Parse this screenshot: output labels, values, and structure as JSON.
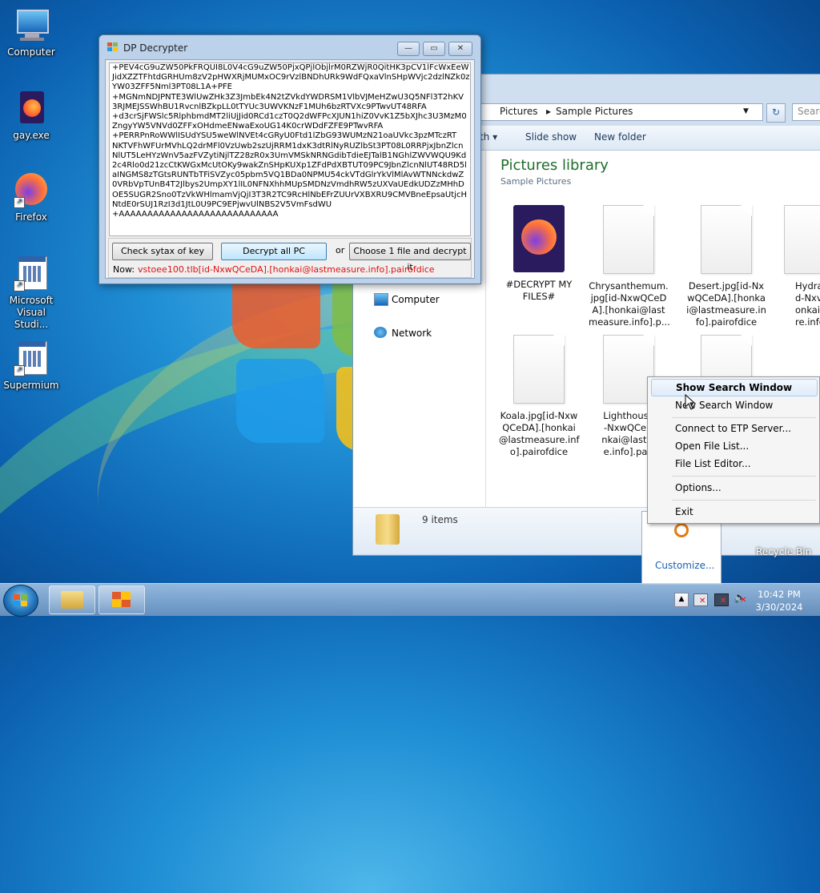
{
  "desktop": {
    "icons": [
      {
        "label": "Computer"
      },
      {
        "label": "gay.exe"
      },
      {
        "label": "Firefox"
      },
      {
        "label_line1": "Microsoft",
        "label_line2": "Visual Studi..."
      },
      {
        "label": "Supermium"
      }
    ],
    "recycle_label": "Recycle Bin"
  },
  "decrypter": {
    "title": "DP Decrypter",
    "key_lines": [
      "+PEV4cG9uZW50PkFRQUI8L0V4cG9uZW50PjxQPjlObjlrM0RZWjR0QitHK3pCV1lFcWxEeW",
      "JidXZZTFhtdGRHUm8zV2pHWXRjMUMxOC9rVzlBNDhURk9WdFQxaVlnSHpWVjc2dzlNZk0z",
      "YW03ZFF5Nml3PT08L1A+PFE",
      "+MGNmNDJPNTE3WlUwZHk3Z3JmbEk4N2tZVkdYWDRSM1VlbVJMeHZwU3Q5NFl3T2hKV",
      "3RJMEJSSWhBU1RvcnlBZkpLL0tTYUc3UWVKNzF1MUh6bzRTVXc9PTwvUT48RFA",
      "+d3crSjFWSlc5RlphbmdMT2liUjJid0RCd1czT0Q2dWFPcXJUN1hiZ0VvK1Z5bXJhc3U3MzM0",
      "ZngyYW5VNVd0ZFFxOHdmeENwaExoUG14K0crWDdFZFE9PTwvRFA",
      "+PERRPnRoWWlISUdYSU5weWlNVEt4cGRyU0Ftd1lZbG93WUMzN21oaUVkc3pzMTczRT",
      "NKTVFhWFUrMVhLQ2drMFl0VzUwb2szUjRRM1dxK3dtRlNyRUZlbSt3PT08L0RRPjxJbnZlcn",
      "NlUT5LeHYzWnV5azFVZytiNjlTZ28zR0x3UmVMSkNRNGdibTdieEJTalB1NGhlZWVWQU9Kd",
      "2c4Rlo0d21zcCtKWGxMcUtOKy9wakZnSHpKUXp1ZFdPdXBTUT09PC9JbnZlcnNlUT48RD5l",
      "aINGMS8zTGtsRUNTbTFiSVZyc05pbm5VQ1BDa0NPMU54ckVTdGlrYkVlMlAvWTNNckdwZ",
      "0VRbVpTUnB4T2Jlbys2UmpXY1lIL0NFNXhhMUpSMDNzVmdhRW5zUXVaUEdkUDZzMHhD",
      "OE5SUGR2Sno0TzVkWHlmamVjQjI3T3R2TC9RcHlNbEFrZUUrVXBXRU9CMVBneEpsaUtjcH",
      "NtdE0rSUJ1RzI3d1JtL0U9PC9EPjwvUlNBS2V5VmFsdWU",
      "+AAAAAAAAAAAAAAAAAAAAAAAAAAAA"
    ],
    "btn_check": "Check sytax of key",
    "btn_decrypt_all": "Decrypt all PC",
    "or_label": "or",
    "btn_choose": "Choose 1 file and decrypt it",
    "now_label": "Now:",
    "now_value": "vstoee100.tlb[id-NxwQCeDA].[honkai@lastmeasure.info].pairofdice"
  },
  "explorer": {
    "breadcrumb": [
      "Pictures",
      "Sample Pictures"
    ],
    "search_placeholder": "Searc",
    "toolbar": {
      "partial": "th",
      "slideshow": "Slide show",
      "new_folder": "New folder"
    },
    "nav": [
      {
        "label": "Computer"
      },
      {
        "label": "Network"
      }
    ],
    "library_title": "Pictures library",
    "library_sub": "Sample Pictures",
    "files": [
      {
        "l1": "#DECRYPT MY",
        "l2": "FILES#",
        "l3": "",
        "l4": ""
      },
      {
        "l1": "Chrysanthemum.",
        "l2": "jpg[id-NxwQCeD",
        "l3": "A].[honkai@last",
        "l4": "measure.info].p..."
      },
      {
        "l1": "Desert.jpg[id-Nx",
        "l2": "wQCeDA].[honka",
        "l3": "i@lastmeasure.in",
        "l4": "fo].pairofdice"
      },
      {
        "l1": "Hydra",
        "l2": "d-Nxv",
        "l3": "onkai",
        "l4": "re.info"
      },
      {
        "l1": "Koala.jpg[id-Nxw",
        "l2": "QCeDA].[honkai",
        "l3": "@lastmeasure.inf",
        "l4": "o].pairofdice"
      },
      {
        "l1": "Lighthouse",
        "l2": "-NxwQCeD",
        "l3": "nkai@lastm",
        "l4": "e.info].pair"
      }
    ],
    "status_count": "9 items"
  },
  "context_menu": {
    "items": [
      "Show Search Window",
      "New Search Window",
      "Connect to ETP Server...",
      "Open File List...",
      "File List Editor...",
      "Options...",
      "Exit"
    ]
  },
  "tray_popup": {
    "customize": "Customize..."
  },
  "taskbar": {
    "time": "10:42 PM",
    "date": "3/30/2024"
  },
  "colors": {
    "accent": "#1e6e2a",
    "error_text": "#e01010",
    "link": "#1a5fb4"
  }
}
